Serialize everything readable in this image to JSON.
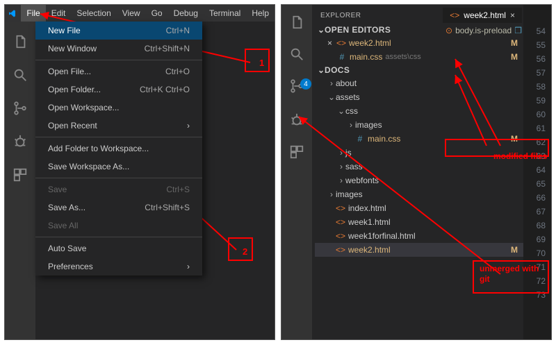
{
  "menubar": {
    "items": [
      "File",
      "Edit",
      "Selection",
      "View",
      "Go",
      "Debug",
      "Terminal",
      "Help"
    ],
    "active": "File"
  },
  "dropdown": {
    "items": [
      {
        "label": "New File",
        "shortcut": "Ctrl+N",
        "highlight": true
      },
      {
        "label": "New Window",
        "shortcut": "Ctrl+Shift+N"
      },
      {
        "sep": true
      },
      {
        "label": "Open File...",
        "shortcut": "Ctrl+O"
      },
      {
        "label": "Open Folder...",
        "shortcut": "Ctrl+K Ctrl+O"
      },
      {
        "label": "Open Workspace..."
      },
      {
        "label": "Open Recent",
        "submenu": true
      },
      {
        "sep": true
      },
      {
        "label": "Add Folder to Workspace..."
      },
      {
        "label": "Save Workspace As..."
      },
      {
        "sep": true
      },
      {
        "label": "Save",
        "shortcut": "Ctrl+S",
        "disabled": true
      },
      {
        "label": "Save As...",
        "shortcut": "Ctrl+Shift+S"
      },
      {
        "label": "Save All",
        "disabled": true
      },
      {
        "sep": true
      },
      {
        "label": "Auto Save"
      },
      {
        "label": "Preferences",
        "submenu": true
      }
    ]
  },
  "explorer": {
    "title": "EXPLORER",
    "open_editors_label": "OPEN EDITORS",
    "open_editors": [
      {
        "icon": "<>",
        "iconcls": "icon-orange",
        "name": "week2.html",
        "status": "M",
        "close": true
      },
      {
        "icon": "#",
        "iconcls": "icon-blue",
        "name": "main.css",
        "dim": "assets\\css",
        "status": "M"
      }
    ],
    "workspace_label": "DOCS",
    "tree": [
      {
        "depth": 1,
        "caret": ">",
        "name": "about"
      },
      {
        "depth": 1,
        "caret": "v",
        "name": "assets"
      },
      {
        "depth": 2,
        "caret": "v",
        "name": "css"
      },
      {
        "depth": 3,
        "caret": ">",
        "name": "images"
      },
      {
        "depth": 3,
        "icon": "#",
        "iconcls": "icon-blue",
        "name": "main.css",
        "status": "M",
        "modified": true
      },
      {
        "depth": 2,
        "caret": ">",
        "name": "js"
      },
      {
        "depth": 2,
        "caret": ">",
        "name": "sass"
      },
      {
        "depth": 2,
        "caret": ">",
        "name": "webfonts"
      },
      {
        "depth": 1,
        "caret": ">",
        "name": "images"
      },
      {
        "depth": 1,
        "icon": "<>",
        "iconcls": "icon-orange",
        "name": "index.html"
      },
      {
        "depth": 1,
        "icon": "<>",
        "iconcls": "icon-orange",
        "name": "week1.html"
      },
      {
        "depth": 1,
        "icon": "<>",
        "iconcls": "icon-orange",
        "name": "week1forfinal.html"
      },
      {
        "depth": 1,
        "icon": "<>",
        "iconcls": "icon-orange",
        "name": "week2.html",
        "status": "M",
        "modified": true,
        "active": true
      }
    ]
  },
  "editor": {
    "tab": {
      "icon": "<>",
      "name": "week2.html"
    },
    "breadcrumb": {
      "icon": "⊙",
      "name": "body.is-preload"
    },
    "line_start": 54,
    "line_end": 73
  },
  "scm_badge": "4",
  "annotations": {
    "box1": "1",
    "box2": "2",
    "label_modified": "modified files",
    "label_unmerged": "unmerged with git"
  }
}
